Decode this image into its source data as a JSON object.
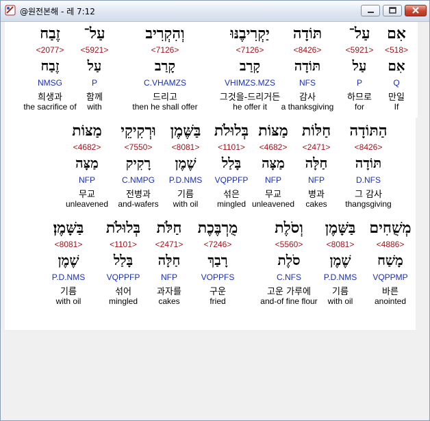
{
  "window": {
    "title": "@원전본해 - 레 7:12",
    "icon": "bible-app-icon",
    "controls": [
      "minimize-icon",
      "maximize-icon",
      "close-icon"
    ]
  },
  "rows": [
    [
      {
        "heb": "אִם",
        "strong": "<518>",
        "lemma": "אִם",
        "morph": "Q",
        "kor": "만일",
        "eng": "If"
      },
      {
        "heb": "עַל־",
        "strong": "<5921>",
        "lemma": "עַל",
        "morph": "P",
        "kor": "하므로",
        "eng": "for"
      },
      {
        "heb": "תּוֹדָה",
        "strong": "<8426>",
        "lemma": "תּוֹדָה",
        "morph": "NFS",
        "kor": "감사",
        "eng": "a thanksgiving"
      },
      {
        "heb": "יַקְרִיבֶנּוּ",
        "strong": "<7126>",
        "lemma": "קָרַב",
        "morph": "VHIMZS.MZS",
        "kor": "그것을-드리거든",
        "eng": "he offer it"
      },
      {
        "heb": "וְהִקְרִיב",
        "strong": "<7126>",
        "lemma": "קָרַב",
        "morph": "C.VHAMZS",
        "kor": "드리고",
        "eng": "then he shall offer"
      },
      {
        "heb": "עַל־",
        "strong": "<5921>",
        "lemma": "עַל",
        "morph": "P",
        "kor": "함께",
        "eng": "with"
      },
      {
        "heb": "זֶבַח",
        "strong": "<2077>",
        "lemma": "זֶבַח",
        "morph": "NMSG",
        "kor": "희생과",
        "eng": "the sacrifice of"
      }
    ],
    [
      {
        "heb": "הַתּוֹדָה",
        "strong": "<8426>",
        "lemma": "תּוֹדָה",
        "morph": "D.NFS",
        "kor": "그 감사",
        "eng": "thangsgiving"
      },
      {
        "heb": "חַלּוֹת",
        "strong": "<2471>",
        "lemma": "חַלָּה",
        "morph": "NFP",
        "kor": "병과",
        "eng": "cakes"
      },
      {
        "heb": "מַצּוֹת",
        "strong": "<4682>",
        "lemma": "מַצָּה",
        "morph": "NFP",
        "kor": "무교",
        "eng": "unleavened"
      },
      {
        "heb": "בְּלוּלֹת",
        "strong": "<1101>",
        "lemma": "בָּלַל",
        "morph": "VQPPFP",
        "kor": "섞은",
        "eng": "mingled"
      },
      {
        "heb": "בַּשֶּׁמֶן",
        "strong": "<8081>",
        "lemma": "שֶׁמֶן",
        "morph": "P.D.NMS",
        "kor": "기름",
        "eng": "with oil"
      },
      {
        "heb": "וּרְקִיקֵי",
        "strong": "<7550>",
        "lemma": "רָקִיק",
        "morph": "C.NMPG",
        "kor": "전병과",
        "eng": "and-wafers"
      },
      {
        "heb": "מַצּוֹת",
        "strong": "<4682>",
        "lemma": "מַצָּה",
        "morph": "NFP",
        "kor": "무교",
        "eng": "unleavened"
      }
    ],
    [
      {
        "heb": "מְשֻׁחִים",
        "strong": "<4886>",
        "lemma": "מָשַׁח",
        "morph": "VQPPMP",
        "kor": "바른",
        "eng": "anointed"
      },
      {
        "heb": "בַּשָּׁמֶן",
        "strong": "<8081>",
        "lemma": "שֶׁמֶן",
        "morph": "P.D.NMS",
        "kor": "기름",
        "eng": "with oil"
      },
      {
        "heb": "וְסֹלֶת",
        "strong": "<5560>",
        "lemma": "סֹלֶת",
        "morph": "C.NFS",
        "kor": "고운 가루에",
        "eng": "and-of fine flour"
      },
      {
        "heb": "מֻרְבֶּכֶת",
        "strong": "<7246>",
        "lemma": "רָבַךְ",
        "morph": "VOPPFS",
        "kor": "구운",
        "eng": "fried"
      },
      {
        "heb": "חַלֹּת",
        "strong": "<2471>",
        "lemma": "חַלָּה",
        "morph": "NFP",
        "kor": "과자를",
        "eng": "cakes"
      },
      {
        "heb": "בְּלוּלֹת",
        "strong": "<1101>",
        "lemma": "בָּלַל",
        "morph": "VQPPFP",
        "kor": "섞어",
        "eng": "mingled"
      },
      {
        "heb": "בַּשָּׁמֶן׃",
        "strong": "<8081>",
        "lemma": "שֶׁמֶן",
        "morph": "P.D.NMS",
        "kor": "기름",
        "eng": "with oil"
      }
    ]
  ]
}
